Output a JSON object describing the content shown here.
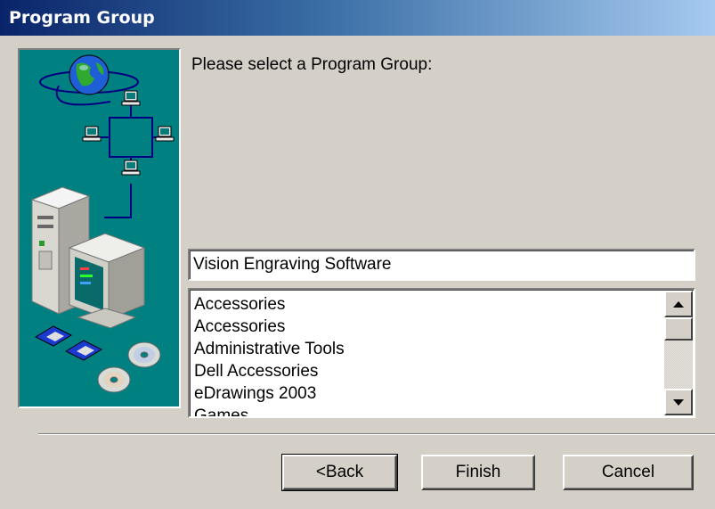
{
  "window": {
    "title": "Program Group"
  },
  "prompt": "Please select a Program Group:",
  "program_group_field": {
    "value": "Vision Engraving Software"
  },
  "program_group_list": {
    "items": [
      "Accessories",
      "Accessories",
      "Administrative Tools",
      "Dell Accessories",
      "eDrawings 2003",
      "Games"
    ]
  },
  "buttons": {
    "back": "<Back",
    "finish": "Finish",
    "cancel": "Cancel"
  },
  "colors": {
    "sidebar_bg": "#008080",
    "titlebar_start": "#0a246a",
    "titlebar_end": "#a6caf0",
    "dialog_bg": "#d4d0c8"
  },
  "icons": [
    "globe-icon",
    "network-computer-icon",
    "desktop-computer-icon",
    "floppy-disk-icon",
    "cd-icon",
    "scroll-up-arrow-icon",
    "scroll-down-arrow-icon"
  ]
}
